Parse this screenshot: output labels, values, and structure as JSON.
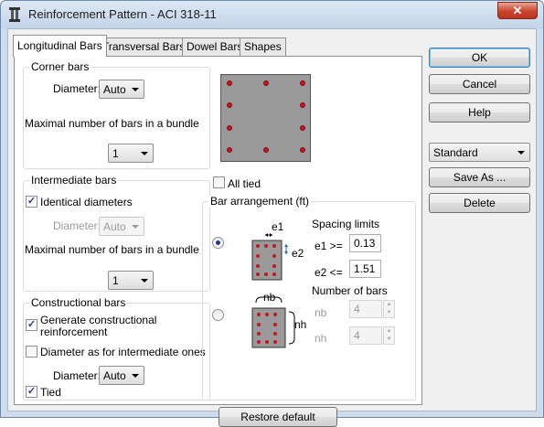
{
  "window": {
    "title": "Reinforcement Pattern - ACI 318-11",
    "close_glyph": "✕"
  },
  "tabs": [
    {
      "label": "Longitudinal Bars",
      "active": true
    },
    {
      "label": "Transversal Bars",
      "active": false
    },
    {
      "label": "Dowel Bars",
      "active": false
    },
    {
      "label": "Shapes",
      "active": false
    }
  ],
  "corner_bars": {
    "title": "Corner bars",
    "diameter_label": "Diameter:",
    "diameter_value": "Auto",
    "max_bundle_label": "Maximal number of bars in a bundle",
    "max_bundle_value": "1"
  },
  "intermediate_bars": {
    "title": "Intermediate bars",
    "identical_label": "Identical diameters",
    "identical_checked": true,
    "diameter_label": "Diameter:",
    "diameter_value": "Auto",
    "max_bundle_label": "Maximal number of bars in a bundle",
    "max_bundle_value": "1"
  },
  "constructional_bars": {
    "title": "Constructional bars",
    "generate_label_1": "Generate constructional",
    "generate_label_2": "reinforcement",
    "generate_checked": true,
    "diameter_as_label": "Diameter as for intermediate ones",
    "diameter_as_checked": false,
    "diameter_label": "Diameter:",
    "diameter_value": "Auto",
    "tied_label": "Tied",
    "tied_checked": true
  },
  "all_tied": {
    "label": "All tied",
    "checked": false
  },
  "bar_arrangement": {
    "title": "Bar arrangement (ft)",
    "option1_selected": true,
    "option2_selected": false,
    "spacing_label": "Spacing limits",
    "e1_label": "e1 >=",
    "e1_value": "0.13",
    "e2_label": "e2 <=",
    "e2_value": "1.51",
    "diag_e1": "e1",
    "diag_e2": "e2",
    "number_label": "Number of bars",
    "nb_label": "nb",
    "nb_value": "4",
    "nh_label": "nh",
    "nh_value": "4",
    "diag_nb": "nb",
    "diag_nh": "nh"
  },
  "restore_button": "Restore default",
  "side_buttons": {
    "ok": "OK",
    "cancel": "Cancel",
    "help": "Help"
  },
  "preset": {
    "value": "Standard"
  },
  "save_as": "Save As ...",
  "delete": "Delete",
  "colors": {
    "rebar": "#c8161e",
    "section": "#9a9a9a",
    "accent": "#3c7fb1"
  }
}
